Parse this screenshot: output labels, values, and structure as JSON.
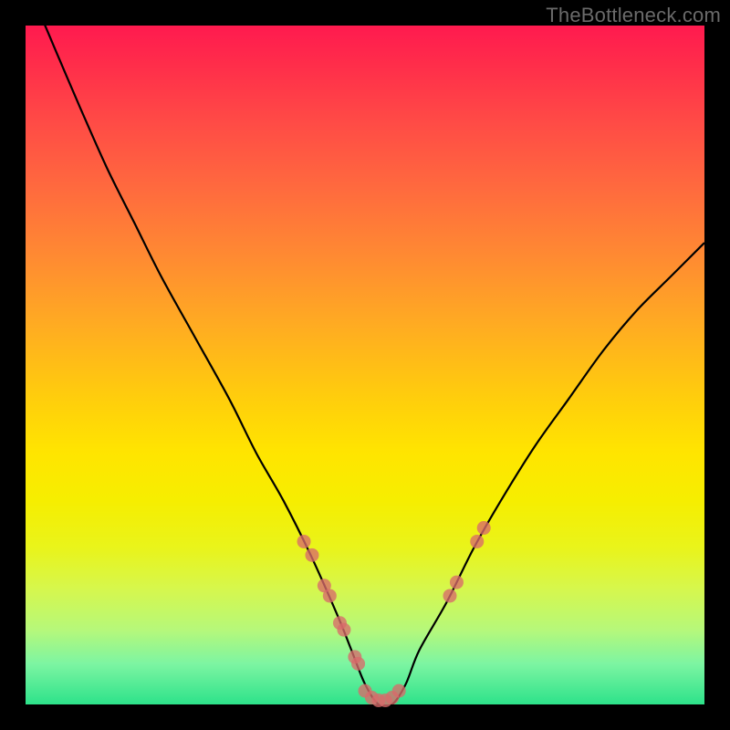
{
  "watermark": "TheBottleneck.com",
  "chart_data": {
    "type": "line",
    "title": "",
    "subtitle": "",
    "xlabel": "",
    "ylabel": "",
    "xlim": [
      0,
      100
    ],
    "ylim": [
      0,
      100
    ],
    "grid": false,
    "legend": false,
    "annotations": [],
    "series": [
      {
        "name": "curve",
        "color": "#000000",
        "x": [
          0,
          2,
          5,
          8,
          12,
          16,
          20,
          25,
          30,
          34,
          38,
          42,
          46,
          48,
          50,
          52,
          54,
          56,
          58,
          62,
          66,
          70,
          75,
          80,
          85,
          90,
          95,
          100
        ],
        "y": [
          106,
          102,
          95,
          88,
          79,
          71,
          63,
          54,
          45,
          37,
          30,
          22,
          13,
          8,
          3,
          0,
          0,
          3,
          8,
          15,
          23,
          30,
          38,
          45,
          52,
          58,
          63,
          68
        ]
      },
      {
        "name": "markers-left",
        "color": "#d86a6a",
        "type": "scatter",
        "x": [
          41.0,
          42.2,
          44.0,
          44.8,
          46.3,
          46.9,
          48.5,
          49.0
        ],
        "y": [
          24.0,
          22.0,
          17.5,
          16.0,
          12.0,
          11.0,
          7.0,
          6.0
        ]
      },
      {
        "name": "markers-bottom",
        "color": "#d86a6a",
        "type": "scatter",
        "x": [
          50.0,
          51.0,
          52.0,
          53.0,
          54.0,
          55.0
        ],
        "y": [
          2.0,
          1.0,
          0.6,
          0.6,
          1.0,
          2.0
        ]
      },
      {
        "name": "markers-right",
        "color": "#d86a6a",
        "type": "scatter",
        "x": [
          62.5,
          63.5,
          66.5,
          67.5
        ],
        "y": [
          16.0,
          18.0,
          24.0,
          26.0
        ]
      }
    ],
    "note": "Axis tick labels are not visible in the source image; x and y values above are expressed as percentages of the inner plot area (0=left/bottom, 100=right/top). Values are estimated from the rendered curve and marker positions."
  }
}
